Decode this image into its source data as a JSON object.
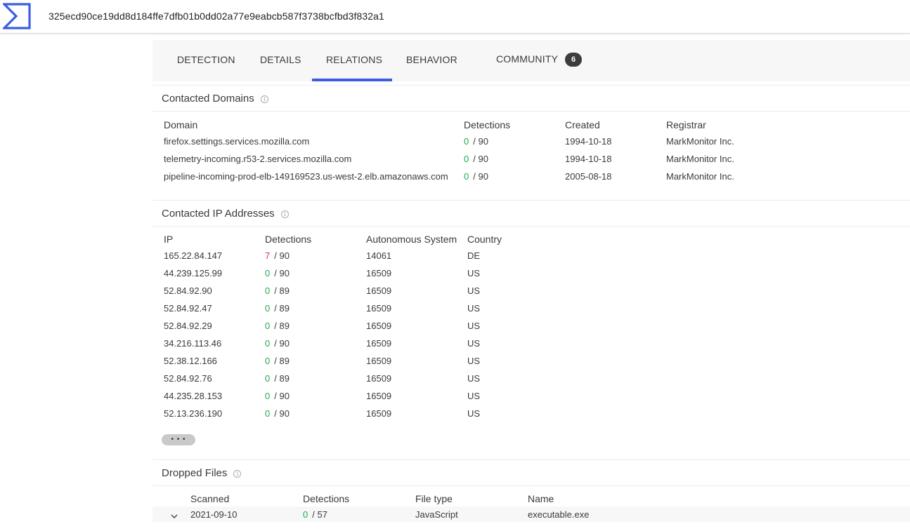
{
  "header": {
    "hash": "325ecd90ce19dd8d184ffe7dfb01b0dd02a77e9eabcb587f3738bcfbd3f832a1"
  },
  "tabs": [
    {
      "label": "DETECTION"
    },
    {
      "label": "DETAILS"
    },
    {
      "label": "RELATIONS",
      "active": true
    },
    {
      "label": "BEHAVIOR"
    },
    {
      "label": "COMMUNITY",
      "badge": "6"
    }
  ],
  "domains": {
    "title": "Contacted Domains",
    "columns": [
      "Domain",
      "Detections",
      "Created",
      "Registrar"
    ],
    "rows": [
      {
        "domain": "firefox.settings.services.mozilla.com",
        "det": "0",
        "total": "/ 90",
        "created": "1994-10-18",
        "registrar": "MarkMonitor Inc."
      },
      {
        "domain": "telemetry-incoming.r53-2.services.mozilla.com",
        "det": "0",
        "total": "/ 90",
        "created": "1994-10-18",
        "registrar": "MarkMonitor Inc."
      },
      {
        "domain": "pipeline-incoming-prod-elb-149169523.us-west-2.elb.amazonaws.com",
        "det": "0",
        "total": "/ 90",
        "created": "2005-08-18",
        "registrar": "MarkMonitor Inc."
      }
    ]
  },
  "ips": {
    "title": "Contacted IP Addresses",
    "columns": [
      "IP",
      "Detections",
      "Autonomous System",
      "Country"
    ],
    "rows": [
      {
        "ip": "165.22.84.147",
        "det": "7",
        "total": "/ 90",
        "as": "14061",
        "country": "DE"
      },
      {
        "ip": "44.239.125.99",
        "det": "0",
        "total": "/ 90",
        "as": "16509",
        "country": "US"
      },
      {
        "ip": "52.84.92.90",
        "det": "0",
        "total": "/ 89",
        "as": "16509",
        "country": "US"
      },
      {
        "ip": "52.84.92.47",
        "det": "0",
        "total": "/ 89",
        "as": "16509",
        "country": "US"
      },
      {
        "ip": "52.84.92.29",
        "det": "0",
        "total": "/ 89",
        "as": "16509",
        "country": "US"
      },
      {
        "ip": "34.216.113.46",
        "det": "0",
        "total": "/ 90",
        "as": "16509",
        "country": "US"
      },
      {
        "ip": "52.38.12.166",
        "det": "0",
        "total": "/ 89",
        "as": "16509",
        "country": "US"
      },
      {
        "ip": "52.84.92.76",
        "det": "0",
        "total": "/ 89",
        "as": "16509",
        "country": "US"
      },
      {
        "ip": "44.235.28.153",
        "det": "0",
        "total": "/ 90",
        "as": "16509",
        "country": "US"
      },
      {
        "ip": "52.13.236.190",
        "det": "0",
        "total": "/ 90",
        "as": "16509",
        "country": "US"
      }
    ],
    "more_label": "• • •"
  },
  "dropped": {
    "title": "Dropped Files",
    "columns": [
      "Scanned",
      "Detections",
      "File type",
      "Name"
    ],
    "rows": [
      {
        "scanned": "2021-09-10",
        "det": "0",
        "total": "/ 57",
        "filetype": "JavaScript",
        "name": "executable.exe"
      }
    ]
  },
  "info_glyph": "i",
  "colors": {
    "accent": "#3b5ee0",
    "positive": "#e0354a",
    "clean": "#1fa854"
  }
}
